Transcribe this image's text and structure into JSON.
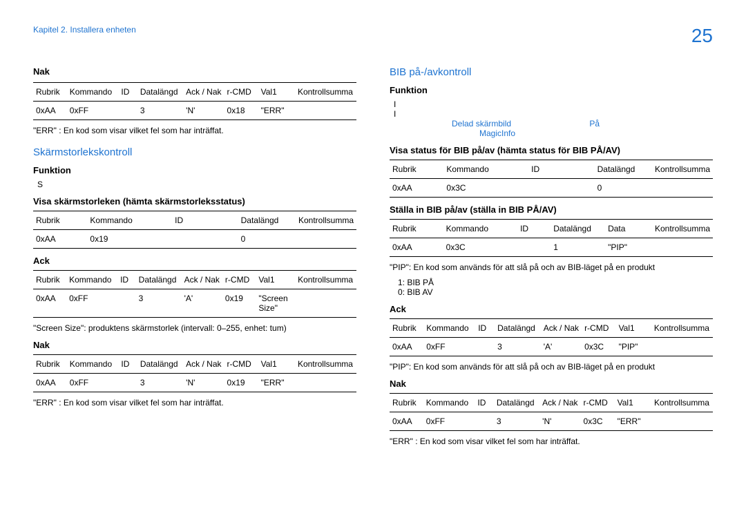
{
  "header": {
    "breadcrumb": "Kapitel 2. Installera enheten",
    "page_number": "25"
  },
  "left": {
    "nak1": {
      "title": "Nak",
      "headers": [
        "Rubrik",
        "Kommando",
        "ID",
        "Datalängd",
        "Ack / Nak",
        "r-CMD",
        "Val1",
        "Kontrollsumma"
      ],
      "row": [
        "0xAA",
        "0xFF",
        "",
        "3",
        "'N'",
        "0x18",
        "\"ERR\"",
        ""
      ],
      "note": "\"ERR\" : En kod som visar vilket fel som har inträffat."
    },
    "screen": {
      "title": "Skärmstorlekskontroll",
      "funk_title": "Funktion",
      "funk_text": "S",
      "view_title": "Visa skärmstorleken (hämta skärmstorleksstatus)",
      "view_headers": [
        "Rubrik",
        "Kommando",
        "ID",
        "Datalängd",
        "Kontrollsumma"
      ],
      "view_row": [
        "0xAA",
        "0x19",
        "",
        "0",
        ""
      ],
      "ack_title": "Ack",
      "ack_headers": [
        "Rubrik",
        "Kommando",
        "ID",
        "Datalängd",
        "Ack / Nak",
        "r-CMD",
        "Val1",
        "Kontrollsumma"
      ],
      "ack_row": [
        "0xAA",
        "0xFF",
        "",
        "3",
        "'A'",
        "0x19",
        "\"Screen Size\"",
        ""
      ],
      "ack_note": "\"Screen Size\": produktens skärmstorlek (intervall: 0–255, enhet: tum)",
      "nak_title": "Nak",
      "nak_headers": [
        "Rubrik",
        "Kommando",
        "ID",
        "Datalängd",
        "Ack / Nak",
        "r-CMD",
        "Val1",
        "Kontrollsumma"
      ],
      "nak_row": [
        "0xAA",
        "0xFF",
        "",
        "3",
        "'N'",
        "0x19",
        "\"ERR\"",
        ""
      ],
      "nak_note": "\"ERR\" : En kod som visar vilket fel som har inträffat."
    }
  },
  "right": {
    "bib": {
      "title": "BIB på-/avkontroll",
      "funk_title": "Funktion",
      "funk_line1": "I",
      "funk_line2": "I",
      "blue1a": "Delad skärmbild",
      "blue1b": "På",
      "blue2": "MagicInfo",
      "status_title": "Visa status för BIB på/av (hämta status för BIB PÅ/AV)",
      "status_headers": [
        "Rubrik",
        "Kommando",
        "ID",
        "Datalängd",
        "Kontrollsumma"
      ],
      "status_row": [
        "0xAA",
        "0x3C",
        "",
        "0",
        ""
      ],
      "set_title": "Ställa in BIB på/av (ställa in BIB PÅ/AV)",
      "set_headers": [
        "Rubrik",
        "Kommando",
        "ID",
        "Datalängd",
        "Data",
        "Kontrollsumma"
      ],
      "set_row": [
        "0xAA",
        "0x3C",
        "",
        "1",
        "\"PIP\"",
        ""
      ],
      "set_note": "\"PIP\": En kod som används för att slå på och av BIB-läget på en produkt",
      "set_a": "1: BIB PÅ",
      "set_b": "0: BIB AV",
      "ack_title": "Ack",
      "ack_headers": [
        "Rubrik",
        "Kommando",
        "ID",
        "Datalängd",
        "Ack / Nak",
        "r-CMD",
        "Val1",
        "Kontrollsumma"
      ],
      "ack_row": [
        "0xAA",
        "0xFF",
        "",
        "3",
        "'A'",
        "0x3C",
        "\"PIP\"",
        ""
      ],
      "ack_note": "\"PIP\": En kod som används för att slå på och av BIB-läget på en produkt",
      "nak_title": "Nak",
      "nak_headers": [
        "Rubrik",
        "Kommando",
        "ID",
        "Datalängd",
        "Ack / Nak",
        "r-CMD",
        "Val1",
        "Kontrollsumma"
      ],
      "nak_row": [
        "0xAA",
        "0xFF",
        "",
        "3",
        "'N'",
        "0x3C",
        "\"ERR\"",
        ""
      ],
      "nak_note": "\"ERR\" : En kod som visar vilket fel som har inträffat."
    }
  }
}
